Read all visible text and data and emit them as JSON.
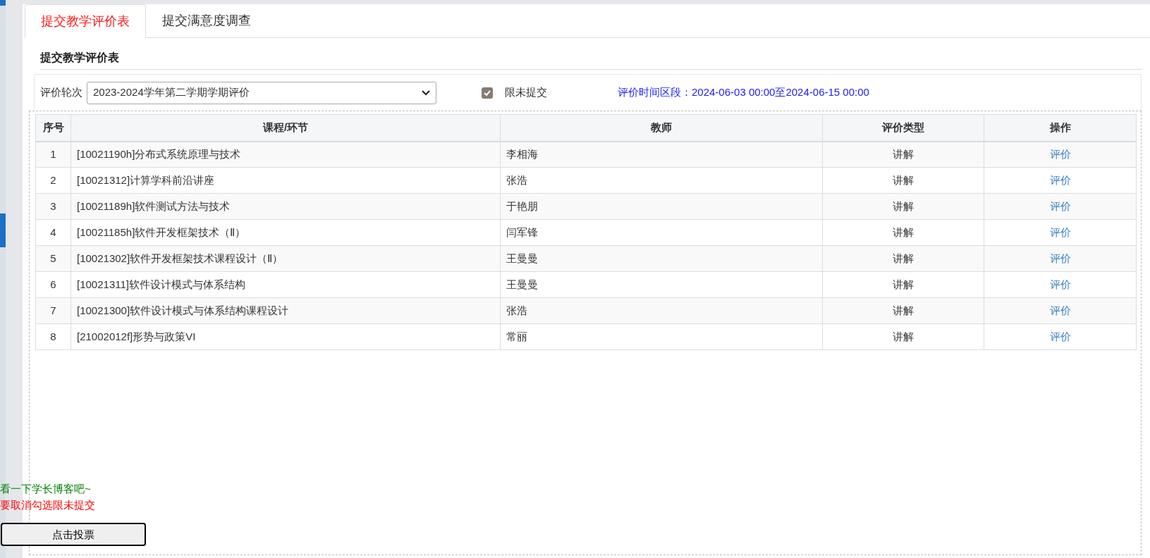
{
  "tabs": [
    {
      "label": "提交教学评价表",
      "selected": true
    },
    {
      "label": "提交满意度调查",
      "selected": false
    }
  ],
  "section_title": "提交教学评价表",
  "filter": {
    "label": "评价轮次",
    "value": "2023-2024学年第二学期学期评价",
    "only_unsubmitted": {
      "label": "限未提交",
      "checked": true
    },
    "period": "评价时间区段：2024-06-03 00:00至2024-06-15 00:00"
  },
  "table": {
    "columns": [
      "序号",
      "课程/环节",
      "教师",
      "评价类型",
      "操作"
    ],
    "rows": [
      {
        "no": "1",
        "course": "[10021190h]分布式系统原理与技术",
        "teacher": "李相海",
        "type": "讲解",
        "action": "评价"
      },
      {
        "no": "2",
        "course": "[10021312]计算学科前沿讲座",
        "teacher": "张浩",
        "type": "讲解",
        "action": "评价"
      },
      {
        "no": "3",
        "course": "[10021189h]软件测试方法与技术",
        "teacher": "于艳朋",
        "type": "讲解",
        "action": "评价"
      },
      {
        "no": "4",
        "course": "[10021185h]软件开发框架技术（Ⅱ）",
        "teacher": "闫军锋",
        "type": "讲解",
        "action": "评价"
      },
      {
        "no": "5",
        "course": "[10021302]软件开发框架技术课程设计（Ⅱ）",
        "teacher": "王曼曼",
        "type": "讲解",
        "action": "评价"
      },
      {
        "no": "6",
        "course": "[10021311]软件设计模式与体系结构",
        "teacher": "王曼曼",
        "type": "讲解",
        "action": "评价"
      },
      {
        "no": "7",
        "course": "[10021300]软件设计模式与体系结构课程设计",
        "teacher": "张浩",
        "type": "讲解",
        "action": "评价"
      },
      {
        "no": "8",
        "course": "[21002012f]形势与政策VI",
        "teacher": "常丽",
        "type": "讲解",
        "action": "评价"
      }
    ]
  },
  "overlay": {
    "note": "看一下学长博客吧~",
    "warning": "要取消勾选限未提交",
    "button": "点击投票"
  }
}
